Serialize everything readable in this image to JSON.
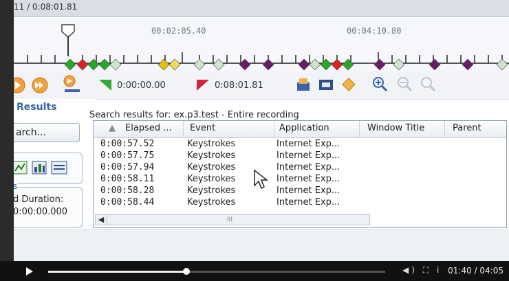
{
  "window": {
    "time_readout": "11 / 0:08:01.81"
  },
  "timeline": {
    "label_a": "00:02:05.40",
    "label_b": "00:04:10.80"
  },
  "toolbar": {
    "start_time": "0:00:00.00",
    "end_time": "0:08:01.81"
  },
  "left_panel": {
    "results_title": "Results",
    "search_button": "arch...",
    "durations_header": "s",
    "duration_label": "d Duration:",
    "duration_value": "0:00:00.000"
  },
  "search": {
    "caption": "Search results for: ex.p3.test - Entire recording"
  },
  "grid": {
    "columns": [
      "Elapsed ...",
      "Event",
      "Application",
      "Window Title",
      "Parent"
    ],
    "rows": [
      {
        "elapsed": "0:00:57.52",
        "event": "Keystrokes",
        "app": "Internet Exp..."
      },
      {
        "elapsed": "0:00:57.75",
        "event": "Keystrokes",
        "app": "Internet Exp..."
      },
      {
        "elapsed": "0:00:57.94",
        "event": "Keystrokes",
        "app": "Internet Exp..."
      },
      {
        "elapsed": "0:00:58.11",
        "event": "Keystrokes",
        "app": "Internet Exp..."
      },
      {
        "elapsed": "0:00:58.28",
        "event": "Keystrokes",
        "app": "Internet Exp..."
      },
      {
        "elapsed": "0:00:58.44",
        "event": "Keystrokes",
        "app": "Internet Exp..."
      }
    ],
    "scroll_grip": "III"
  },
  "player": {
    "time": "01:40 / 04:05",
    "progress": 0.41
  },
  "colors": {
    "accent": "#3a63a6",
    "green_marker": "#22aa22",
    "red_marker": "#dd2222",
    "purple_marker": "#6a1b6a",
    "yellow_marker": "#e6c200"
  },
  "icons": [
    "play-icon",
    "fast-forward-icon",
    "start-flag-icon",
    "end-flag-icon",
    "export-icon",
    "camera-icon",
    "diamond-icon",
    "zoom-in-icon",
    "zoom-out-icon",
    "zoom-fit-icon",
    "volume-icon",
    "fullscreen-icon"
  ]
}
